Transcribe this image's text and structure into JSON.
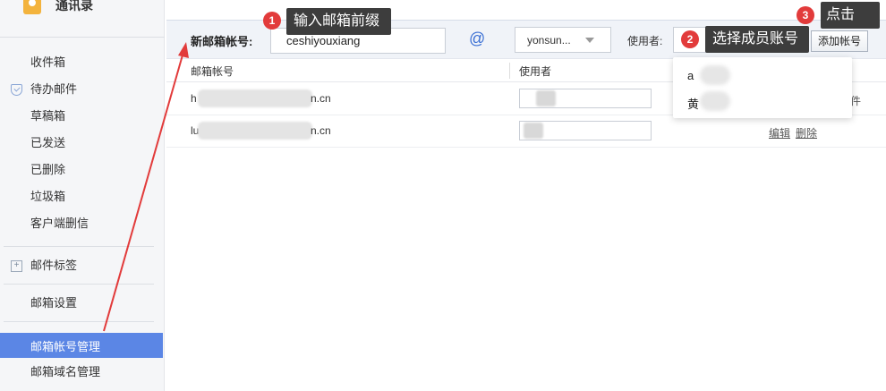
{
  "sidebar": {
    "contacts": "通讯录",
    "folders": [
      "收件箱",
      "待办邮件",
      "草稿箱",
      "已发送",
      "已删除",
      "垃圾箱",
      "客户端删信"
    ],
    "tags": "邮件标签",
    "settings": "邮箱设置",
    "active": "邮箱帐号管理",
    "domain_manage": "邮箱域名管理"
  },
  "toolbar": {
    "new_account_label": "新邮箱帐号:",
    "prefix_value": "ceshiyouxiang",
    "at": "@",
    "domain_value": "yonsun...",
    "user_label": "使用者:",
    "add_button": "添加帐号"
  },
  "table": {
    "headers": [
      "邮箱帐号",
      "使用者"
    ],
    "rows": [
      {
        "email_start": "h",
        "email_end": "n.cn"
      },
      {
        "email_start": "lu",
        "email_end": "n.cn"
      }
    ],
    "row1_partial_link": "件",
    "edit": "编辑",
    "delete": "删除"
  },
  "dropdown": {
    "options": [
      "a",
      "黄"
    ]
  },
  "callouts": {
    "step1": "1",
    "step1_text": "输入邮箱前缀",
    "step2": "2",
    "step2_text": "选择成员账号",
    "step3": "3",
    "step3_text": "点击"
  },
  "colors": {
    "accent": "#5b86e5",
    "annotation_red": "#e23b3b",
    "callout_bg": "#3d3d3d"
  }
}
